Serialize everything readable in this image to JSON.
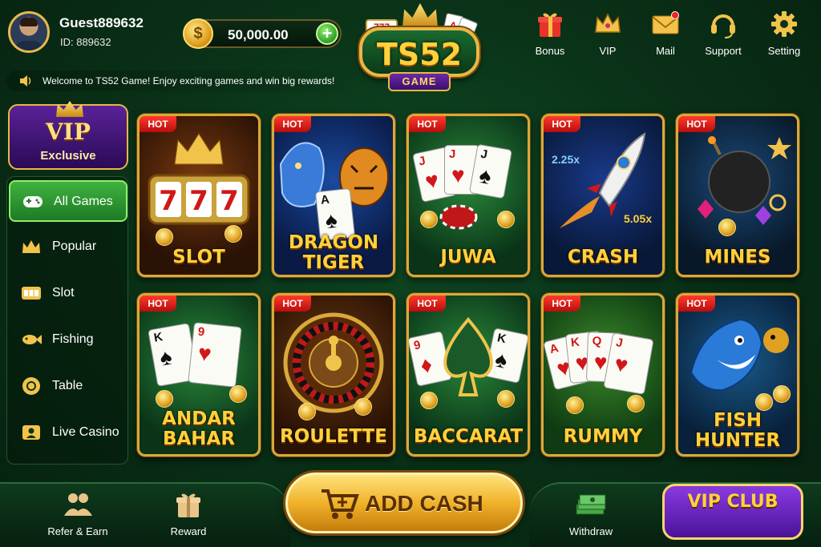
{
  "user": {
    "name": "Guest889632",
    "id": "ID: 889632"
  },
  "wallet": {
    "balance": "50,000.00",
    "coin_symbol": "$",
    "add_symbol": "+"
  },
  "logo": {
    "text": "TS52",
    "subtext": "GAME",
    "reel": "777"
  },
  "top_nav": [
    {
      "label": "Bonus",
      "icon": "gift-icon"
    },
    {
      "label": "VIP",
      "icon": "crown-icon"
    },
    {
      "label": "Mail",
      "icon": "mail-icon"
    },
    {
      "label": "Support",
      "icon": "headset-icon"
    },
    {
      "label": "Setting",
      "icon": "gear-icon"
    }
  ],
  "marquee": {
    "text": "Welcome to TS52 Game! Enjoy exciting games and win big rewards!"
  },
  "vip_badge": {
    "title": "VIP",
    "subtitle": "Exclusive"
  },
  "sidebar": [
    {
      "label": "All Games",
      "icon": "gamepad-icon",
      "active": true
    },
    {
      "label": "Popular",
      "icon": "crown-icon",
      "active": false
    },
    {
      "label": "Slot",
      "icon": "slot-machine-icon",
      "active": false
    },
    {
      "label": "Fishing",
      "icon": "fish-icon",
      "active": false
    },
    {
      "label": "Table",
      "icon": "poker-chip-icon",
      "active": false
    },
    {
      "label": "Live Casino",
      "icon": "live-dealer-icon",
      "active": false
    }
  ],
  "games": [
    {
      "badge": "HOT",
      "title": "SLOT"
    },
    {
      "badge": "HOT",
      "title": "DRAGON TIGER"
    },
    {
      "badge": "HOT",
      "title": "JUWA"
    },
    {
      "badge": "HOT",
      "title": "CRASH",
      "multipliers": [
        "2.25x",
        "5.05x"
      ]
    },
    {
      "badge": "HOT",
      "title": "MINES"
    },
    {
      "badge": "HOT",
      "title": "ANDAR BAHAR"
    },
    {
      "badge": "HOT",
      "title": "ROULETTE"
    },
    {
      "badge": "HOT",
      "title": "BACCARAT"
    },
    {
      "badge": "HOT",
      "title": "RUMMY"
    },
    {
      "badge": "HOT",
      "title": "FISH HUNTER"
    }
  ],
  "bottom_nav": {
    "refer": "Refer & Earn",
    "reward": "Reward",
    "add_cash": "ADD CASH",
    "withdraw": "Withdraw",
    "vip_club": "VIP CLUB"
  },
  "colors": {
    "accent_gold": "#ffd13b",
    "bg_green": "#0a3318",
    "hot_red": "#e0201a",
    "active_green": "#2e9f2c",
    "vip_purple": "#5a2298"
  }
}
